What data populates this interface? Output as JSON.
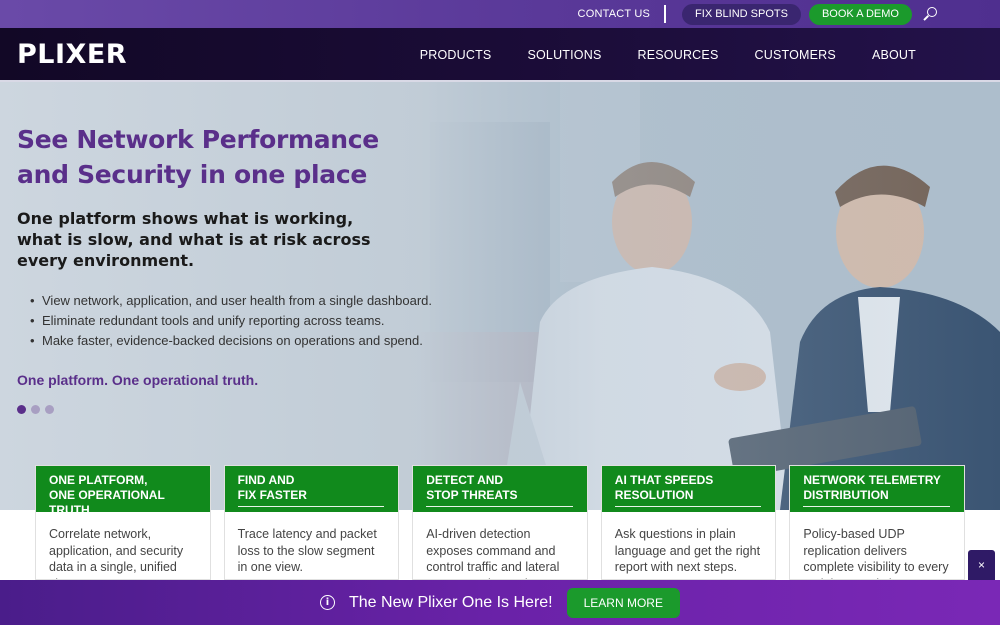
{
  "utility_bar": {
    "contact_label": "CONTACT US",
    "fix_blind_spots_label": "FIX BLIND SPOTS",
    "book_demo_label": "BOOK A DEMO",
    "search_icon": "search-icon"
  },
  "nav": {
    "logo": "PLIXER",
    "items": [
      {
        "label": "PRODUCTS"
      },
      {
        "label": "SOLUTIONS"
      },
      {
        "label": "RESOURCES"
      },
      {
        "label": "CUSTOMERS"
      },
      {
        "label": "ABOUT"
      }
    ]
  },
  "hero": {
    "title_line1": "See Network Performance",
    "title_line2": "and Security in one place",
    "subtitle": "One platform shows what is working, what is slow, and what is at risk across every environment.",
    "bullets": [
      "View network, application, and user health from a single dashboard.",
      "Eliminate redundant tools and unify reporting across teams.",
      "Make faster, evidence-backed decisions on operations and spend."
    ],
    "tagline": "One platform. One operational truth.",
    "carousel_active": 1,
    "carousel_count": 3
  },
  "cards": [
    {
      "title": "ONE PLATFORM,\nONE OPERATIONAL TRUTH",
      "body": "Correlate network, application, and security data in a single, unified view."
    },
    {
      "title": "FIND AND\nFIX FASTER",
      "body": "Trace latency and packet loss to the slow segment in one view."
    },
    {
      "title": "DETECT AND\nSTOP THREATS",
      "body": "AI-driven detection exposes command and control traffic and lateral movement instantly."
    },
    {
      "title": "AI THAT SPEEDS\nRESOLUTION",
      "body": "Ask questions in plain language and get the right report with next steps."
    },
    {
      "title": "NETWORK TELEMETRY\nDISTRIBUTION",
      "body": "Policy-based UDP replication delivers complete visibility to every tool that needs it."
    }
  ],
  "banner": {
    "info_icon": "info-icon",
    "text": "The New Plixer One Is Here!",
    "button_label": "LEARN MORE",
    "close_label": "×"
  },
  "colors": {
    "brand_purple": "#5a2f8a",
    "accent_green": "#1b9a2c",
    "card_green": "#118a1c",
    "nav_dark": "#120826"
  }
}
